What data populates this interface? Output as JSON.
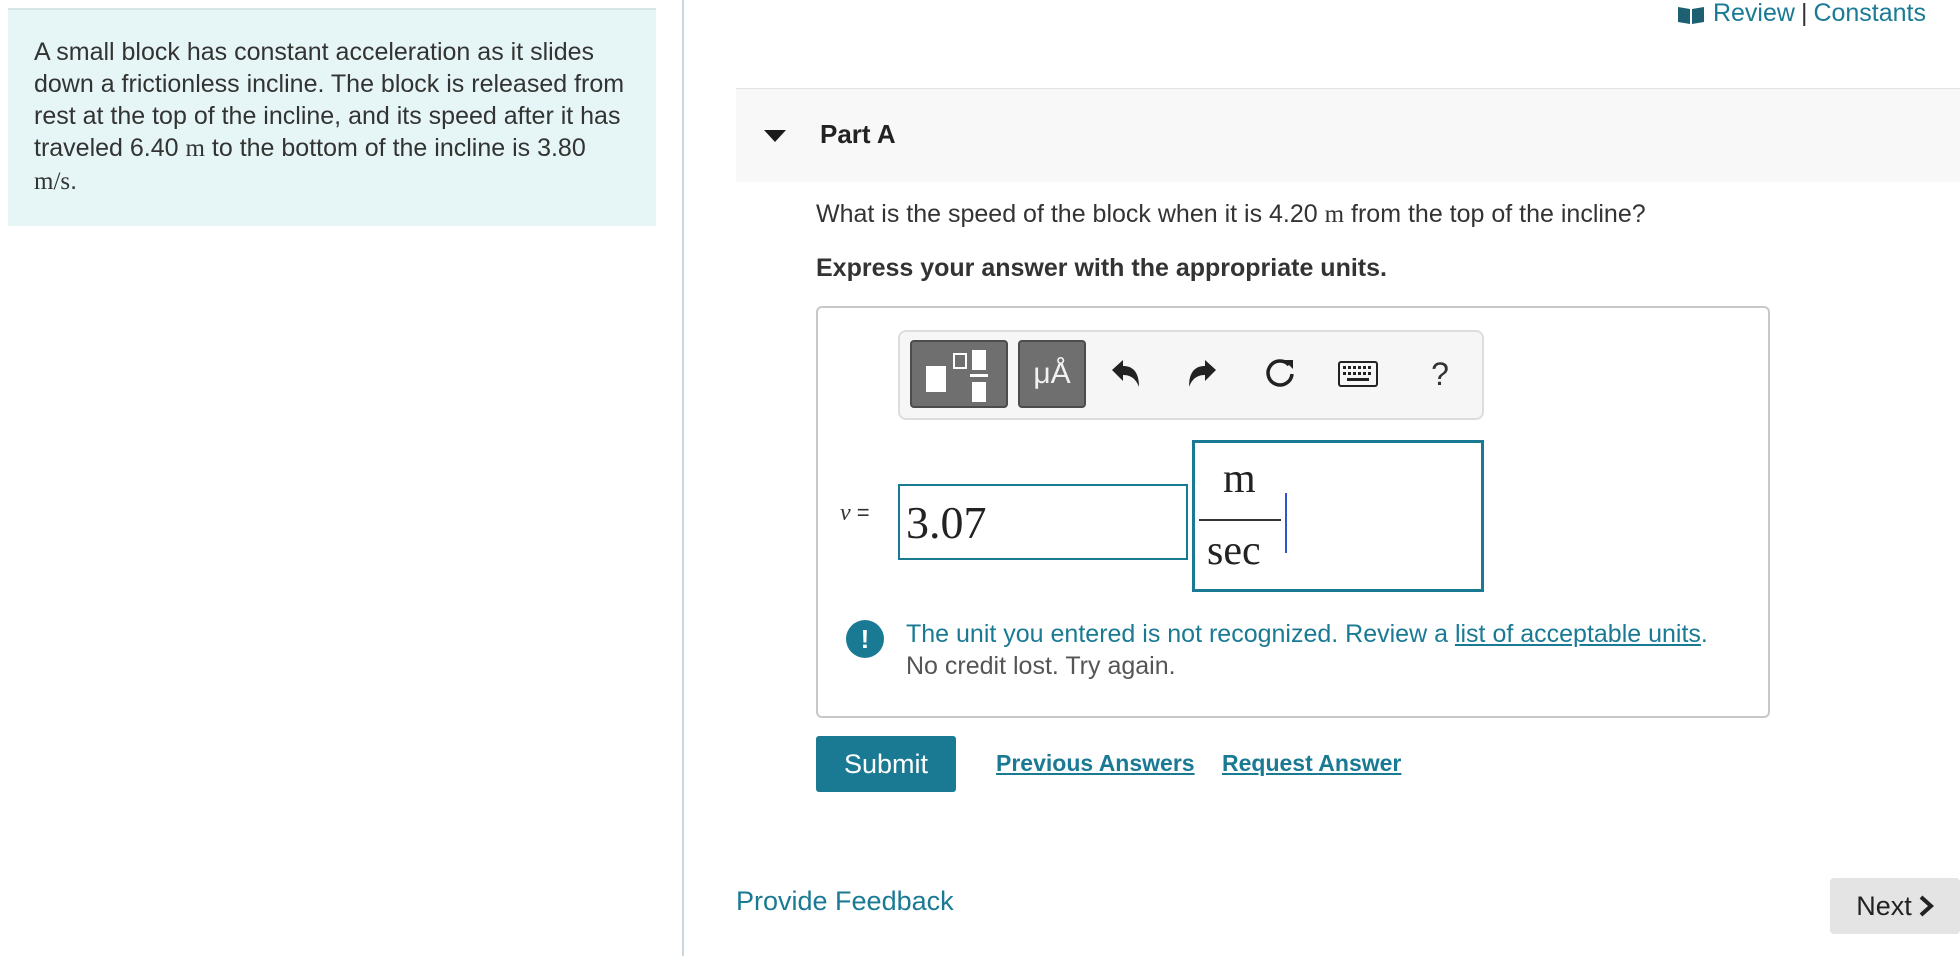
{
  "problem": {
    "text_part1": "A small block has constant acceleration as it slides down a frictionless incline. The block is released from rest at the top of the incline, and its speed after it has traveled 6.40 ",
    "unit_m": "m",
    "text_part2": " to the bottom of the incline is 3.80 ",
    "unit_ms": "m/s",
    "text_part3": "."
  },
  "header_links": {
    "review": "Review",
    "separator": "|",
    "constants": "Constants",
    "icon": "book-icon"
  },
  "part": {
    "title": "Part A",
    "question_part1": "What is the speed of the block when it is 4.20 ",
    "question_unit": "m",
    "question_part2": " from the top of the incline?",
    "instructions": "Express your answer with the appropriate units."
  },
  "toolbar": {
    "units_label": "μÅ",
    "help_label": "?",
    "icons": [
      "templates-icon",
      "units-icon",
      "undo-icon",
      "redo-icon",
      "reset-icon",
      "keyboard-icon",
      "help-icon"
    ]
  },
  "answer": {
    "variable": "v",
    "equals": "=",
    "value": "3.07",
    "unit_numerator": "m",
    "unit_denominator": "sec"
  },
  "feedback": {
    "message_part1": "The unit you entered is not recognized. Review a ",
    "link": "list of acceptable units",
    "message_part2": ".",
    "sub": "No credit lost. Try again."
  },
  "actions": {
    "submit": "Submit",
    "previous_answers": "Previous Answers",
    "request_answer": "Request Answer"
  },
  "footer": {
    "provide_feedback": "Provide Feedback",
    "next": "Next"
  },
  "colors": {
    "accent": "#1a7a94",
    "problem_bg": "#e6f6f6",
    "next_bg": "#e4e4e4"
  }
}
